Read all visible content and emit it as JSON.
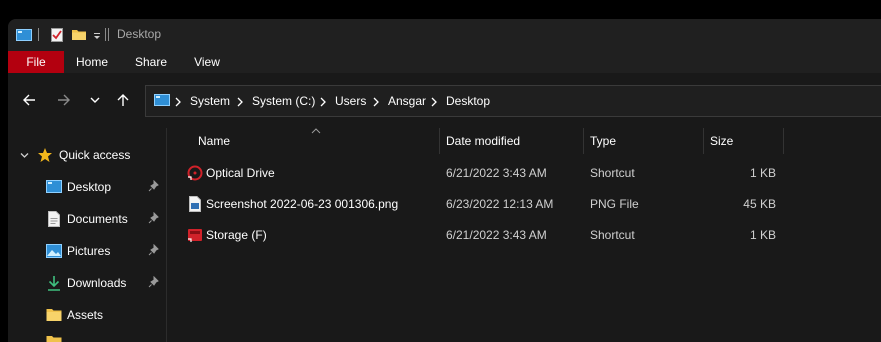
{
  "window": {
    "title": "Desktop"
  },
  "ribbon": {
    "tabs": [
      "File",
      "Home",
      "Share",
      "View"
    ]
  },
  "address": {
    "crumbs": [
      "System",
      "System (C:)",
      "Users",
      "Ansgar",
      "Desktop"
    ]
  },
  "sidebar": {
    "items": [
      {
        "label": "Quick access",
        "icon": "star-icon",
        "pinned": false
      },
      {
        "label": "Desktop",
        "icon": "desktop-folder-icon",
        "pinned": true
      },
      {
        "label": "Documents",
        "icon": "document-icon",
        "pinned": true
      },
      {
        "label": "Pictures",
        "icon": "pictures-icon",
        "pinned": true
      },
      {
        "label": "Downloads",
        "icon": "download-icon",
        "pinned": true
      },
      {
        "label": "Assets",
        "icon": "folder-icon",
        "pinned": false
      }
    ]
  },
  "columns": {
    "name": "Name",
    "date": "Date modified",
    "type": "Type",
    "size": "Size"
  },
  "files": [
    {
      "name": "Optical Drive",
      "date": "6/21/2022 3:43 AM",
      "type": "Shortcut",
      "size": "1 KB",
      "icon": "optical-drive-shortcut-icon"
    },
    {
      "name": "Screenshot 2022-06-23 001306.png",
      "date": "6/23/2022 12:13 AM",
      "type": "PNG File",
      "size": "45 KB",
      "icon": "png-file-icon"
    },
    {
      "name": "Storage (F)",
      "date": "6/21/2022 3:43 AM",
      "type": "Shortcut",
      "size": "1 KB",
      "icon": "storage-shortcut-icon"
    }
  ],
  "colors": {
    "file_tab": "#b3000f",
    "accent_blue": "#3a9fe0",
    "folder_yellow": "#f0c24b",
    "shortcut_red": "#d0222a"
  }
}
